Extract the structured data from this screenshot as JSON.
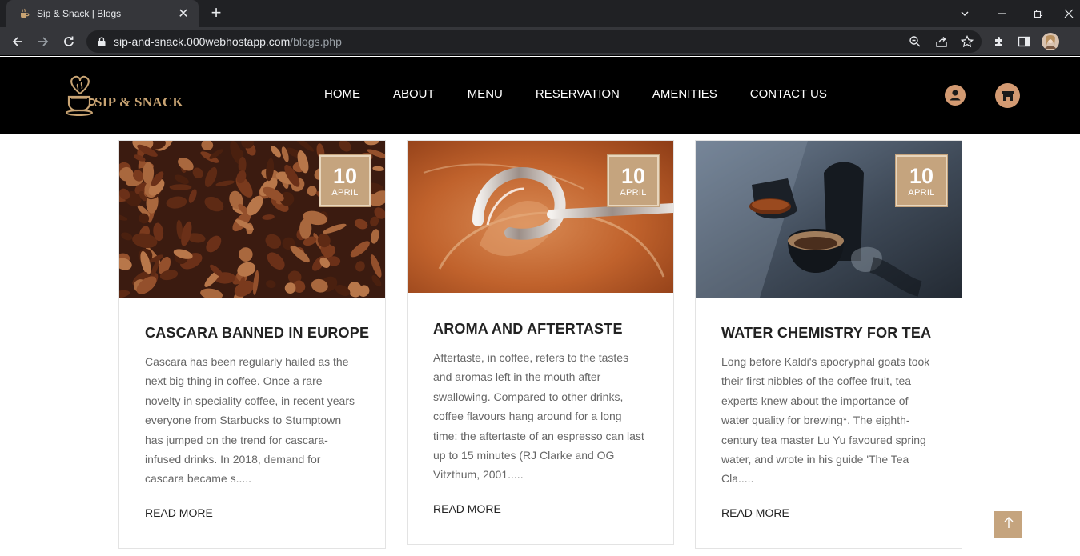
{
  "browser": {
    "tab_title": "Sip & Snack | Blogs",
    "url_host": "sip-and-snack.000webhostapp.com",
    "url_path": "/blogs.php",
    "new_tab_symbol": "+",
    "tab_close_symbol": "✕",
    "icons": [
      "back-arrow-icon",
      "forward-arrow-icon",
      "reload-icon",
      "lock-icon",
      "zoom-icon",
      "share-icon",
      "bookmark-star-icon",
      "extensions-icon",
      "side-panel-icon",
      "profile-avatar-icon"
    ]
  },
  "site": {
    "logo_text": "SIP & SNACK",
    "nav": [
      "HOME",
      "ABOUT",
      "MENU",
      "RESERVATION",
      "AMENITIES",
      "CONTACT US"
    ],
    "header_icons": [
      "user-icon",
      "store-icon"
    ],
    "accent_color": "#c5a47e"
  },
  "posts": [
    {
      "day": "10",
      "month": "APRIL",
      "title": "CASCARA BANNED IN EUROPE",
      "excerpt": "Cascara has been regularly hailed as the next big thing in coffee. Once a rare novelty in speciality coffee, in recent years everyone from Starbucks to Stumptown has jumped on the trend for cascara-infused drinks. In 2018, demand for cascara became s.....",
      "read_more": "READ MORE"
    },
    {
      "day": "10",
      "month": "APRIL",
      "title": "AROMA AND AFTERTASTE",
      "excerpt": "Aftertaste, in coffee, refers to the tastes and aromas left in the mouth after swallowing. Compared to other drinks, coffee flavours hang around for a long time: the aftertaste of an espresso can last up to 15 minutes (RJ Clarke and OG Vitzthum, 2001.....",
      "read_more": "READ MORE"
    },
    {
      "day": "10",
      "month": "APRIL",
      "title": "WATER CHEMISTRY FOR TEA",
      "excerpt": "Long before Kaldi's apocryphal goats took their first nibbles of the coffee fruit, tea experts knew about the importance of water quality for brewing*. The eighth-century tea master Lu Yu favoured spring water, and wrote in his guide 'The Tea Cla.....",
      "read_more": "READ MORE"
    }
  ],
  "scroll_top_icon": "arrow-up-icon"
}
